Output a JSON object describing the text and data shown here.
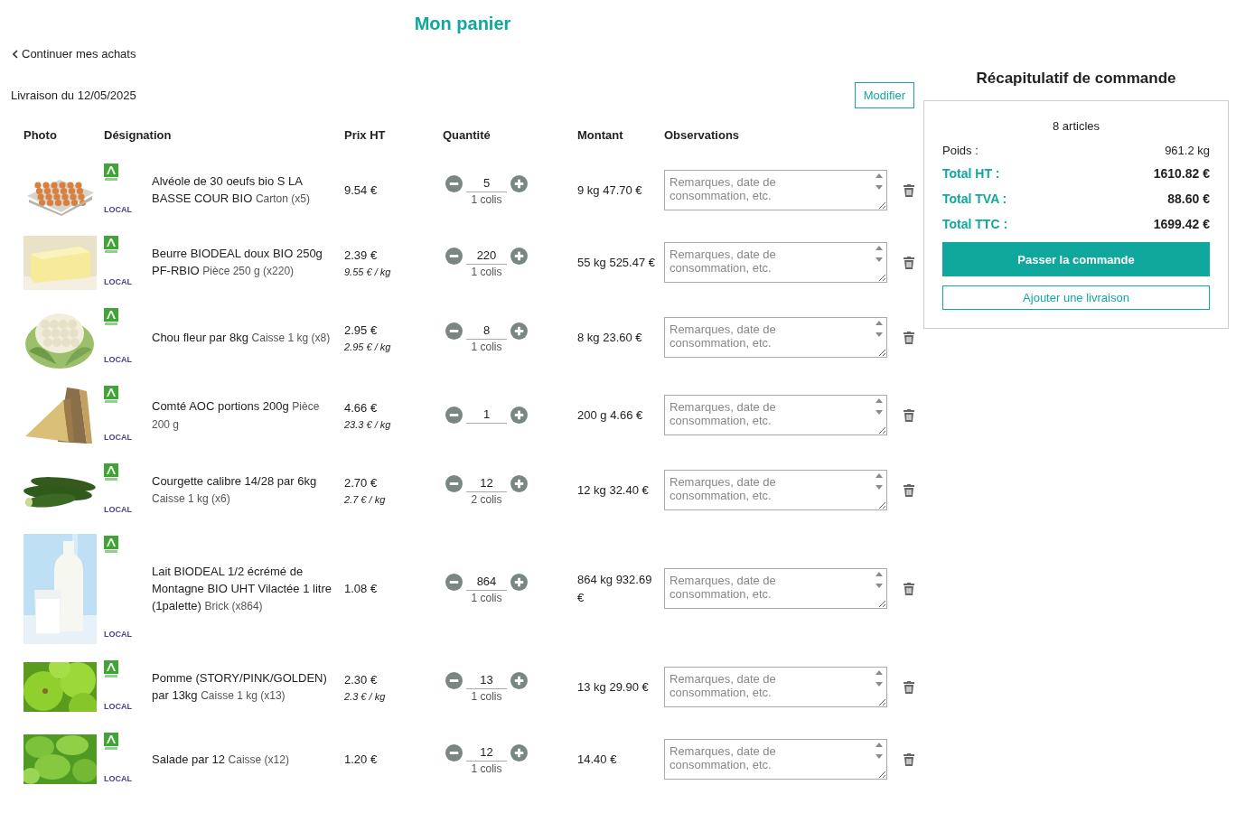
{
  "page_title": "Mon panier",
  "back_link": "Continuer mes achats",
  "delivery": "Livraison du 12/05/2025",
  "modify_button": "Modifier",
  "columns": [
    "Photo",
    "Désignation",
    "Prix HT",
    "Quantité",
    "Montant",
    "Observations"
  ],
  "items": [
    {
      "label": "LOCAL",
      "name": "Alvéole de 30 oeufs bio S LA BASSE COUR BIO",
      "packaging": "Carton (x5)",
      "price": "9.54 €",
      "quantity": "5",
      "packages": "1 colis",
      "amount": "9 kg 47.70 €",
      "remarks_placeholder": "Remarques, date de consommation, etc."
    },
    {
      "label": "LOCAL",
      "name": "Beurre BIODEAL doux BIO 250g PF-RBIO",
      "packaging": "Pièce 250 g (x220)",
      "price": "2.39 €",
      "unit_price": "9.55 € / kg",
      "quantity": "220",
      "packages": "1 colis",
      "amount": "55 kg 525.47 €",
      "remarks_placeholder": "Remarques, date de consommation, etc."
    },
    {
      "label": "LOCAL",
      "name": "Chou fleur par 8kg",
      "packaging": "Caisse 1 kg (x8)",
      "price": "2.95 €",
      "unit_price": "2.95  € / kg",
      "quantity": "8",
      "packages": "1 colis",
      "amount": "8 kg 23.60 €",
      "remarks_placeholder": "Remarques, date de consommation, etc."
    },
    {
      "label": "LOCAL",
      "name": "Comté AOC portions 200g",
      "packaging": "Pièce 200 g",
      "price": "4.66 €",
      "unit_price": "23.3 € / kg",
      "quantity": "1",
      "amount": "200 g 4.66 €",
      "remarks_placeholder": "Remarques, date de consommation, etc."
    },
    {
      "label": "LOCAL",
      "name": "Courgette calibre 14/28 par 6kg",
      "packaging": "Caisse 1 kg (x6)",
      "price": "2.70 €",
      "unit_price": "2.7  € / kg",
      "quantity": "12",
      "packages": "2 colis",
      "amount": "12 kg 32.40 €",
      "remarks_placeholder": "Remarques, date de consommation, etc."
    },
    {
      "label": "LOCAL",
      "name": "Lait BIODEAL 1/2 écrémé de Montagne BIO UHT Vilactée 1 litre (1palette)",
      "packaging": "Brick (x864)",
      "price": "1.08 €",
      "quantity": "864",
      "packages": "1 colis",
      "amount": "864 kg 932.69 €",
      "remarks_placeholder": "Remarques, date de consommation, etc."
    },
    {
      "label": "LOCAL",
      "name": "Pomme (STORY/PINK/GOLDEN) par 13kg",
      "packaging": "Caisse 1 kg (x13)",
      "price": "2.30 €",
      "unit_price": "2.3  € / kg",
      "quantity": "13",
      "packages": "1 colis",
      "amount": "13 kg 29.90 €",
      "remarks_placeholder": "Remarques, date de consommation, etc."
    },
    {
      "label": "LOCAL",
      "name": "Salade par 12",
      "packaging": "Caisse (x12)",
      "price": "1.20 €",
      "quantity": "12",
      "packages": "1 colis",
      "amount": "14.40 €",
      "remarks_placeholder": "Remarques, date de consommation, etc."
    }
  ],
  "summary": {
    "title": "Récapitulatif de commande",
    "count": "8 articles",
    "weight_label": "Poids :",
    "weight": "961.2 kg",
    "totals": [
      {
        "label": "Total HT :",
        "value": "1610.82 €"
      },
      {
        "label": "Total TVA :",
        "value": "88.60 €"
      },
      {
        "label": "Total TTC :",
        "value": "1699.42 €"
      }
    ],
    "primary_button": "Passer la commande",
    "secondary_button": "Ajouter une livraison"
  }
}
